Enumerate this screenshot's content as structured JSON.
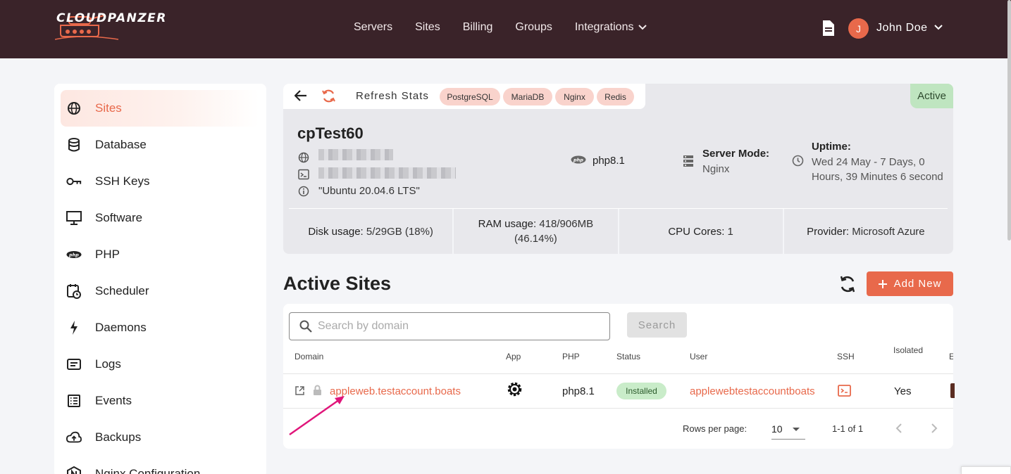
{
  "brand": {
    "name": "CLOUDPANZER"
  },
  "nav": {
    "servers": "Servers",
    "sites": "Sites",
    "billing": "Billing",
    "groups": "Groups",
    "integrations": "Integrations"
  },
  "user": {
    "initial": "J",
    "name": "John Doe"
  },
  "sidebar": {
    "items": [
      {
        "label": "Sites",
        "icon": "globe-icon",
        "active": true
      },
      {
        "label": "Database",
        "icon": "database-icon"
      },
      {
        "label": "SSH Keys",
        "icon": "key-icon"
      },
      {
        "label": "Software",
        "icon": "monitor-icon"
      },
      {
        "label": "PHP",
        "icon": "php-icon"
      },
      {
        "label": "Scheduler",
        "icon": "calendar-clock-icon"
      },
      {
        "label": "Daemons",
        "icon": "bolt-icon"
      },
      {
        "label": "Logs",
        "icon": "logs-icon"
      },
      {
        "label": "Events",
        "icon": "list-icon"
      },
      {
        "label": "Backups",
        "icon": "cloud-upload-icon"
      },
      {
        "label": "Nginx Configuration",
        "icon": "nginx-icon"
      }
    ]
  },
  "server": {
    "toolbar": {
      "refresh_label": "Refresh Stats",
      "chips": [
        "PostgreSQL",
        "MariaDB",
        "Nginx",
        "Redis"
      ]
    },
    "status": "Active",
    "name": "cpTest60",
    "os": "\"Ubuntu 20.04.6 LTS\"",
    "php_version": "php8.1",
    "server_mode_label": "Server Mode:",
    "server_mode_value": "Nginx",
    "uptime_label": "Uptime:",
    "uptime_value": "Wed 24 May - 7 Days, 0 Hours, 39 Minutes 6 second",
    "stats": {
      "disk_label": "Disk usage:",
      "disk_value": "5/29GB (18%)",
      "ram_label": "RAM usage:",
      "ram_value": "418/906MB (46.14%)",
      "cpu_label": "CPU Cores:",
      "cpu_value": "1",
      "provider_label": "Provider:",
      "provider_value": "Microsoft Azure"
    }
  },
  "active_sites": {
    "title": "Active Sites",
    "add_label": "Add New",
    "search_placeholder": "Search by domain",
    "search_button": "Search",
    "columns": {
      "domain": "Domain",
      "app": "App",
      "php": "PHP",
      "status": "Status",
      "user": "User",
      "ssh": "SSH",
      "isolated": "Isolated",
      "extra": "E"
    },
    "rows": [
      {
        "domain": "appleweb.testaccount.boats",
        "php": "php8.1",
        "status": "Installed",
        "user": "applewebtestaccountboats",
        "isolated": "Yes"
      }
    ],
    "footer": {
      "rows_per_page_label": "Rows per page:",
      "rows_per_page_value": "10",
      "range": "1-1 of 1"
    }
  },
  "colors": {
    "accent": "#e8694b",
    "topbar": "#3a2329",
    "active_badge": "#bfe5c0",
    "arrow": "#e0157a"
  }
}
